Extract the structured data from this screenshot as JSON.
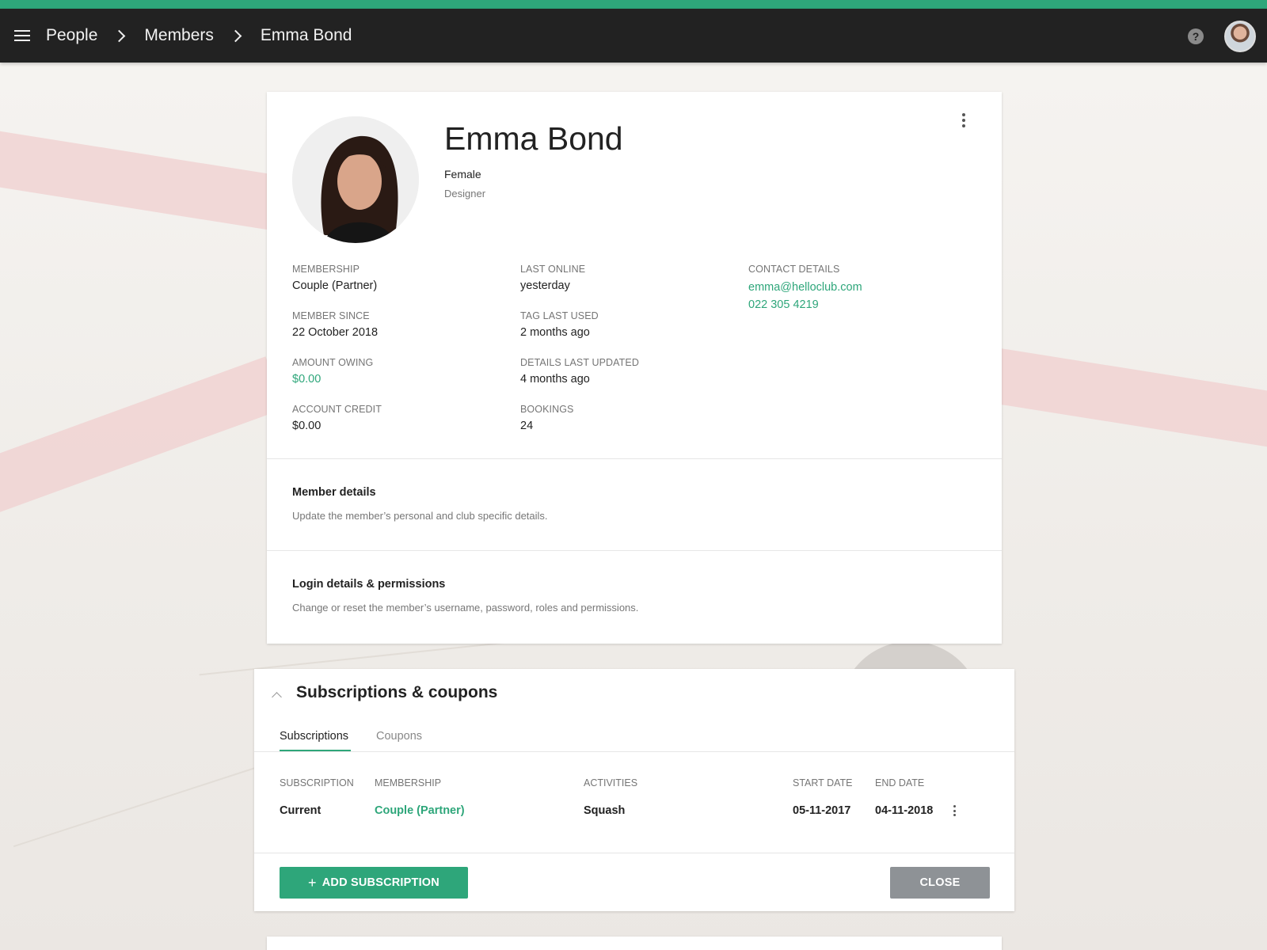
{
  "header": {
    "breadcrumbs": [
      "People",
      "Members",
      "Emma Bond"
    ],
    "help_icon": "?"
  },
  "profile": {
    "name": "Emma Bond",
    "gender": "Female",
    "occupation": "Designer",
    "fields_col1": [
      {
        "label": "MEMBERSHIP",
        "value": "Couple (Partner)"
      },
      {
        "label": "MEMBER SINCE",
        "value": "22 October 2018"
      },
      {
        "label": "AMOUNT OWING",
        "value": "$0.00"
      },
      {
        "label": "ACCOUNT CREDIT",
        "value": "$0.00"
      }
    ],
    "fields_col2": [
      {
        "label": "LAST ONLINE",
        "value": "yesterday"
      },
      {
        "label": "TAG LAST USED",
        "value": "2 months ago"
      },
      {
        "label": "DETAILS LAST UPDATED",
        "value": "4 months ago"
      },
      {
        "label": "BOOKINGS",
        "value": "24"
      }
    ],
    "contact": {
      "label": "CONTACT DETAILS",
      "email": "emma@helloclub.com",
      "phone": "022 305 4219"
    }
  },
  "sections": [
    {
      "title": "Member details",
      "description": "Update the member’s personal and club specific details."
    },
    {
      "title": "Login details & permissions",
      "description": "Change or reset the member’s username, password, roles and permissions."
    }
  ],
  "subscriptions": {
    "title": "Subscriptions & coupons",
    "tabs": [
      "Subscriptions",
      "Coupons"
    ],
    "active_tab": "Subscriptions",
    "columns": [
      "SUBSCRIPTION",
      "MEMBERSHIP",
      "ACTIVITIES",
      "START DATE",
      "END DATE"
    ],
    "rows": [
      {
        "subscription": "Current",
        "membership": "Couple (Partner)",
        "activities": "Squash",
        "start_date": "05-11-2017",
        "end_date": "04-11-2018"
      }
    ],
    "add_button": "ADD SUBSCRIPTION",
    "close_button": "CLOSE"
  },
  "colors": {
    "accent": "#2ea67a",
    "topbar": "#222222",
    "close_button": "#8e9296"
  }
}
